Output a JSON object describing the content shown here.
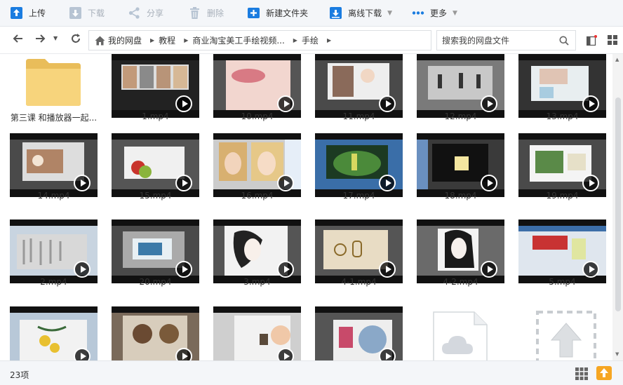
{
  "toolbar": {
    "upload": "上传",
    "download": "下载",
    "share": "分享",
    "delete": "删除",
    "new_folder": "新建文件夹",
    "offline_download": "离线下载",
    "more": "更多"
  },
  "nav": {
    "breadcrumb": [
      "我的网盘",
      "教程",
      "商业淘宝美工手绘视频...",
      "手绘"
    ],
    "search_placeholder": "搜索我的网盘文件"
  },
  "files": [
    {
      "name": "第三课 和播放器一起...",
      "type": "folder"
    },
    {
      "name": "1.mp4",
      "type": "video"
    },
    {
      "name": "10.mp4",
      "type": "video"
    },
    {
      "name": "11.mp4",
      "type": "video"
    },
    {
      "name": "12.mp4",
      "type": "video"
    },
    {
      "name": "13.mp4",
      "type": "video"
    },
    {
      "name": "14.mp4",
      "type": "video"
    },
    {
      "name": "15.mp4",
      "type": "video"
    },
    {
      "name": "16.mp4",
      "type": "video"
    },
    {
      "name": "17.mp4",
      "type": "video"
    },
    {
      "name": "18.mp4",
      "type": "video"
    },
    {
      "name": "19.mp4",
      "type": "video"
    },
    {
      "name": "2.mp4",
      "type": "video"
    },
    {
      "name": "20.mp4",
      "type": "video"
    },
    {
      "name": "3.mp4",
      "type": "video"
    },
    {
      "name": "4-1.mp4",
      "type": "video"
    },
    {
      "name": "4-2.mp4",
      "type": "video"
    },
    {
      "name": "5.mp4",
      "type": "video"
    },
    {
      "name": "",
      "type": "video"
    },
    {
      "name": "",
      "type": "video"
    },
    {
      "name": "",
      "type": "video"
    },
    {
      "name": "",
      "type": "video"
    },
    {
      "name": "",
      "type": "cloud-file"
    },
    {
      "name": "",
      "type": "upload-placeholder"
    }
  ],
  "status": {
    "item_count": "23项"
  },
  "colors": {
    "accent": "#1a7ce0",
    "toolbar_bg": "#f4f6f9",
    "folder": "#f7d47c",
    "upload_badge": "#f6a623"
  }
}
